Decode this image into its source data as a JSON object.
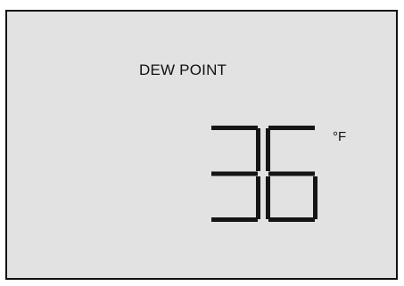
{
  "display": {
    "label": "DEW POINT",
    "value": "36",
    "unit": "°F"
  },
  "colors": {
    "background": "#e2e2e2",
    "segment": "#151515",
    "border": "#111111"
  }
}
